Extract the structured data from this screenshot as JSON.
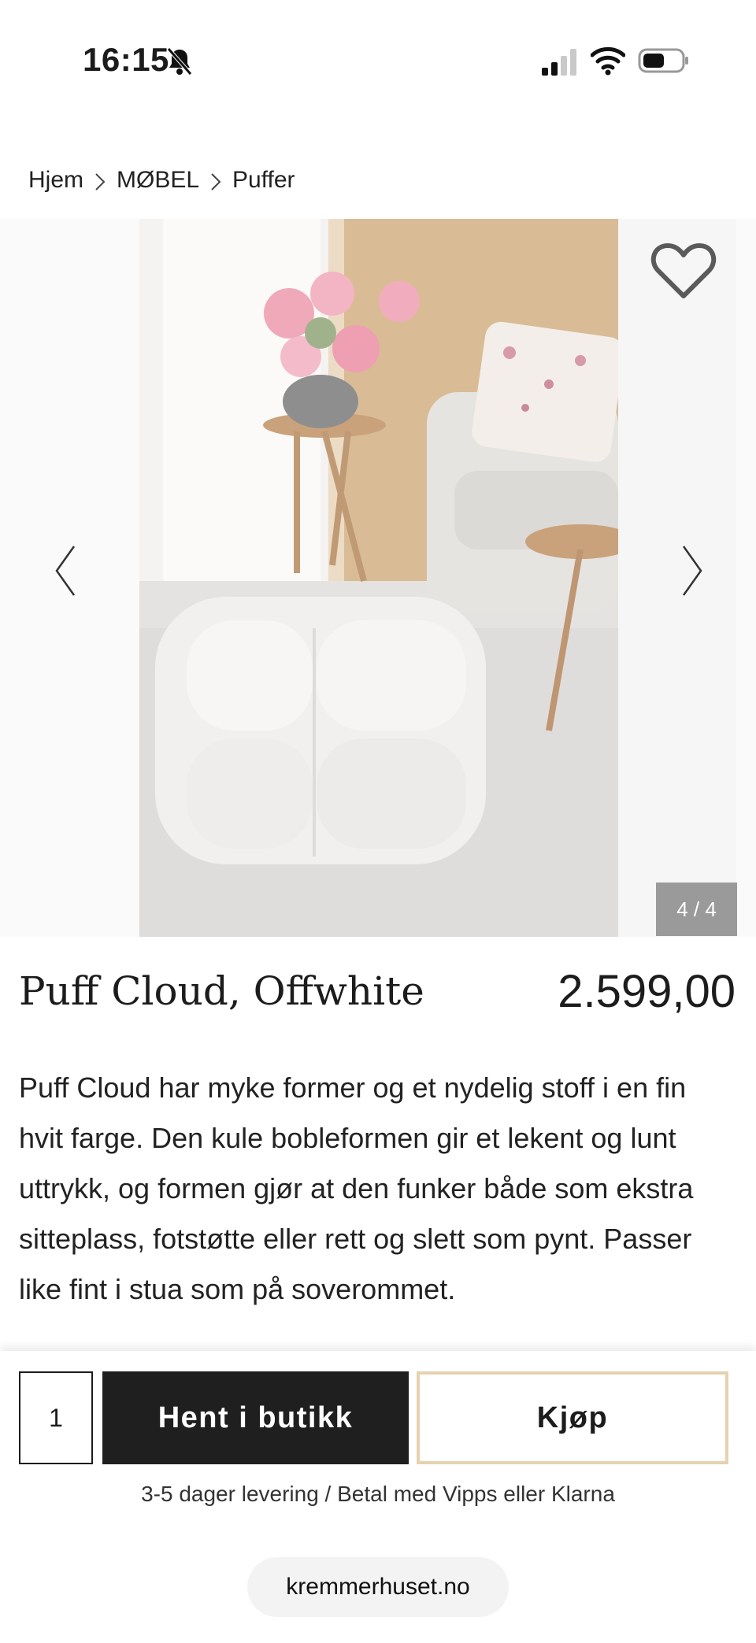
{
  "status_bar": {
    "time": "16:15",
    "icons": [
      "bell-slash-icon",
      "signal-icon",
      "wifi-icon",
      "battery-icon"
    ]
  },
  "breadcrumb": {
    "items": [
      "Hjem",
      "MØBEL",
      "Puffer"
    ]
  },
  "gallery": {
    "counter": "4 / 4",
    "icons": [
      "heart-icon",
      "chevron-left-icon",
      "chevron-right-icon"
    ]
  },
  "product": {
    "title": "Puff Cloud, Offwhite",
    "price": "2.599,00",
    "description": "Puff Cloud har myke former og et nydelig stoff i en fin hvit farge. Den kule bobleformen gir et lekent og lunt uttrykk, og formen gjør at den funker både som ekstra sitteplass, fotstøtte eller rett og slett som pynt. Passer like fint i stua som på soverommet."
  },
  "purchase": {
    "quantity": "1",
    "pickup_label": "Hent i butikk",
    "buy_label": "Kjøp",
    "delivery_note": "3-5 dager levering / Betal med Vipps eller Klarna"
  },
  "browser": {
    "domain": "kremmerhuset.no"
  },
  "colors": {
    "buy_border": "#e6d2b0",
    "pickup_bg": "#1f1f1f",
    "counter_bg": "#9a9a9a"
  }
}
